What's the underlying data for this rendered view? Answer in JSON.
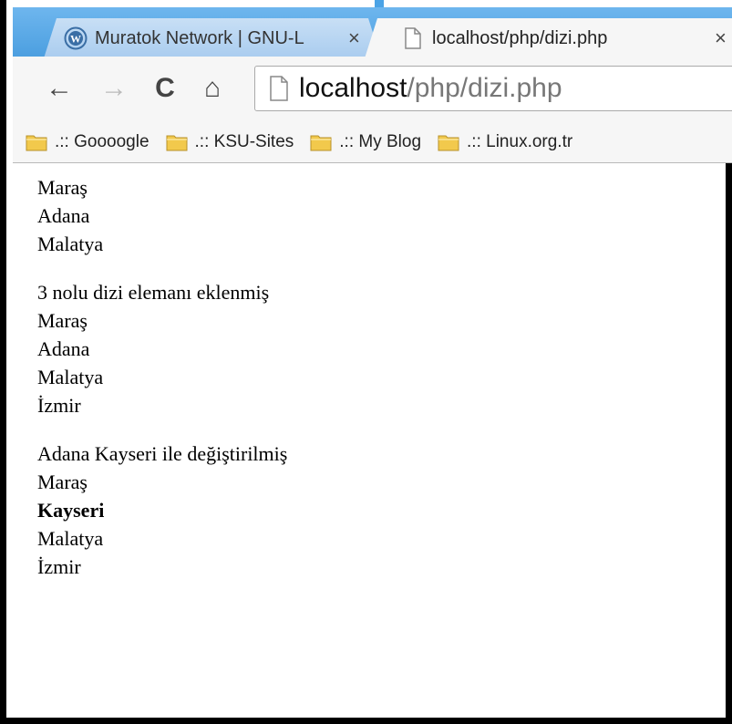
{
  "browser": {
    "tabs": [
      {
        "title": "Muratok Network | GNU-L",
        "close": "×",
        "icon": "wordpress-icon",
        "active": false
      },
      {
        "title": "localhost/php/dizi.php",
        "close": "×",
        "icon": "page-icon",
        "active": true
      }
    ],
    "nav": {
      "back": "←",
      "forward": "→",
      "reload": "C",
      "home": "⌂"
    },
    "address": {
      "host": "localhost",
      "path": "/php/dizi.php"
    },
    "bookmarks": [
      {
        "label": ".:: Goooogle",
        "icon": "folder-icon"
      },
      {
        "label": ".:: KSU-Sites",
        "icon": "folder-icon"
      },
      {
        "label": ".:: My Blog",
        "icon": "folder-icon"
      },
      {
        "label": ".:: Linux.org.tr",
        "icon": "folder-icon"
      }
    ],
    "colors": {
      "tabstrip": "#4c9fe0",
      "toolbar": "#f6f6f6",
      "folder": "#f2c94c"
    }
  },
  "page": {
    "block1": [
      "Maraş",
      "Adana",
      "Malatya"
    ],
    "block2_heading": "3 nolu dizi elemanı eklenmiş",
    "block2": [
      "Maraş",
      "Adana",
      "Malatya",
      "İzmir"
    ],
    "block3_heading": "Adana Kayseri ile değiştirilmiş",
    "block3": [
      "Maraş",
      "Kayseri",
      "Malatya",
      "İzmir"
    ]
  }
}
